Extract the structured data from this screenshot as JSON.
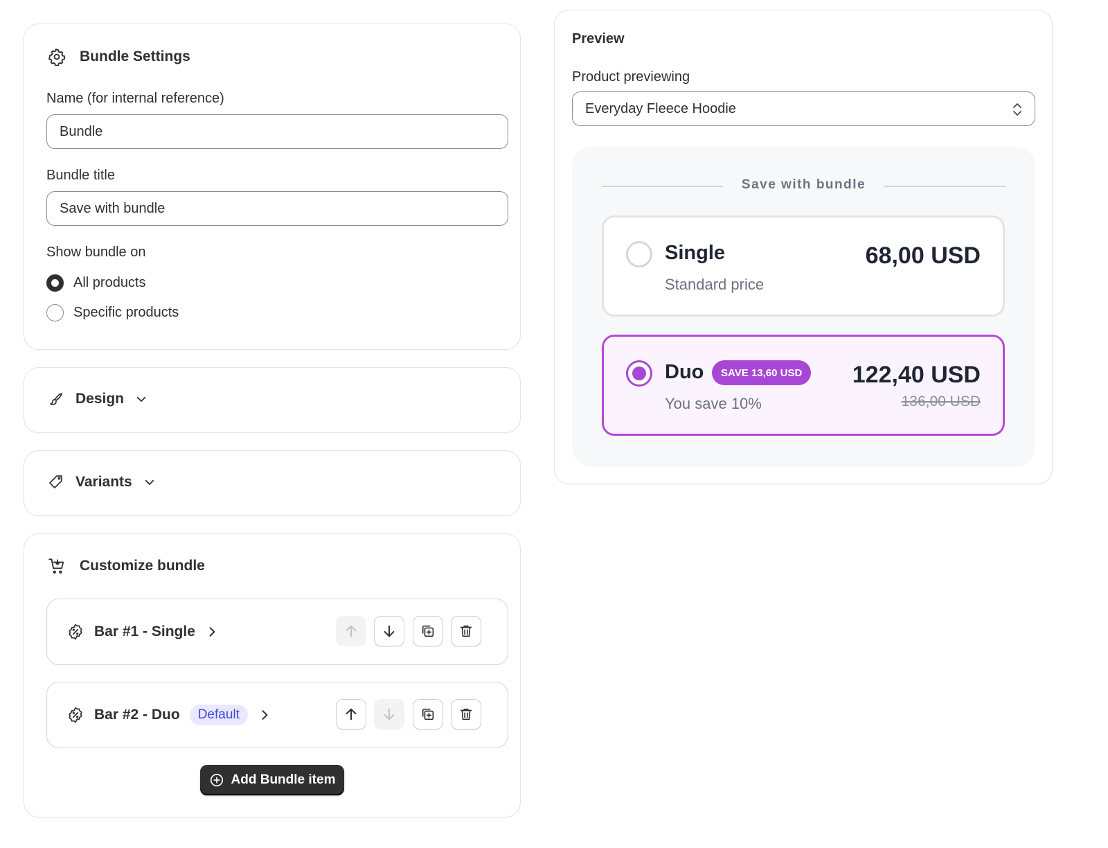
{
  "settings": {
    "title": "Bundle Settings",
    "name_label": "Name (for internal reference)",
    "name_value": "Bundle",
    "bundle_title_label": "Bundle title",
    "bundle_title_value": "Save with bundle",
    "show_on_label": "Show bundle on",
    "options": [
      {
        "label": "All products",
        "checked": true
      },
      {
        "label": "Specific products",
        "checked": false
      }
    ]
  },
  "design": {
    "label": "Design"
  },
  "variants": {
    "label": "Variants"
  },
  "customize": {
    "title": "Customize bundle",
    "bars": [
      {
        "label": "Bar #1 - Single",
        "badge": ""
      },
      {
        "label": "Bar #2 - Duo",
        "badge": "Default"
      }
    ],
    "add_label": "Add Bundle item"
  },
  "preview": {
    "title": "Preview",
    "product_label": "Product previewing",
    "product_value": "Everyday Fleece Hoodie",
    "heading": "Save with bundle",
    "single": {
      "title": "Single",
      "subtitle": "Standard price",
      "price": "68,00 USD"
    },
    "duo": {
      "title": "Duo",
      "badge": "SAVE 13,60 USD",
      "subtitle": "You save 10%",
      "price": "122,40 USD",
      "compare_price": "136,00 USD"
    }
  },
  "colors": {
    "accent": "#a847d6",
    "dark": "#303030",
    "default_badge": "#4449d8"
  }
}
